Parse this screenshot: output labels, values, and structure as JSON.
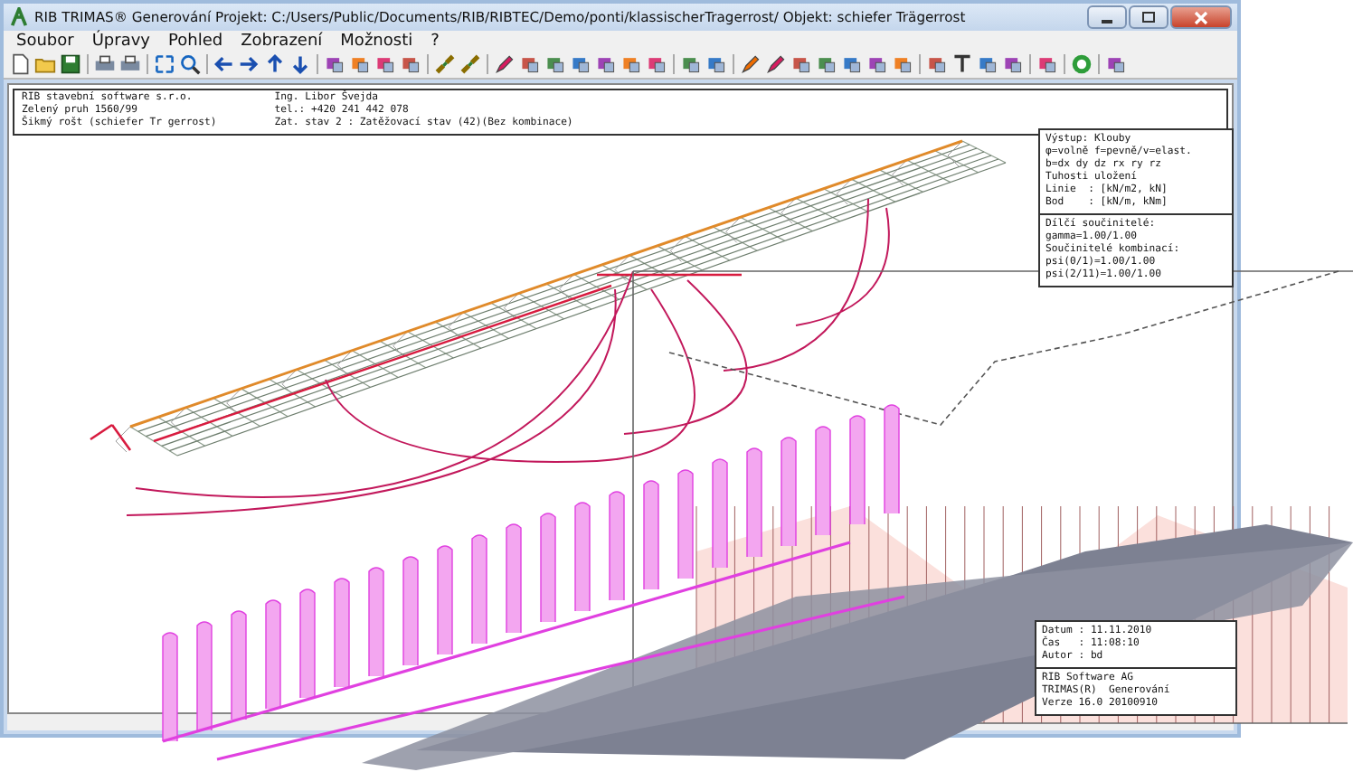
{
  "window": {
    "title": "RIB TRIMAS®  Generování  Projekt: C:/Users/Public/Documents/RIB/RIBTEC/Demo/ponti/klassischerTragerrost/   Objekt: schiefer Trägerrost"
  },
  "menu": [
    "Soubor",
    "Úpravy",
    "Pohled",
    "Zobrazení",
    "Možnosti",
    "?"
  ],
  "header": {
    "left": [
      "RIB stavební software s.r.o.",
      "Zelený pruh 1560/99",
      "Šikmý rošt (schiefer Tr gerrost)"
    ],
    "right": [
      "Ing. Libor Švejda",
      "tel.: +420 241 442 078",
      "Zat. stav 2 : Zatěžovací stav (42)(Bez kombinace)"
    ]
  },
  "legend": [
    [
      "Výstup: Klouby",
      "φ=volně f=pevně/v=elast.",
      "b=dx dy dz rx ry rz",
      "Tuhosti uložení",
      "Linie  : [kN/m2, kN]",
      "Bod    : [kN/m, kNm]"
    ],
    [
      "Dílčí součinitelé:",
      "gamma=1.00/1.00",
      "Součinitelé kombinací:",
      "psi(0/1)=1.00/1.00",
      "psi(2/11)=1.00/1.00"
    ]
  ],
  "stamp": [
    [
      "Datum : 11.11.2010",
      "Čas   : 11:08:10",
      "Autor : bd"
    ],
    [
      "RIB Software AG",
      "TRIMAS(R)  Generování",
      "Verze 16.0 20100910"
    ]
  ]
}
